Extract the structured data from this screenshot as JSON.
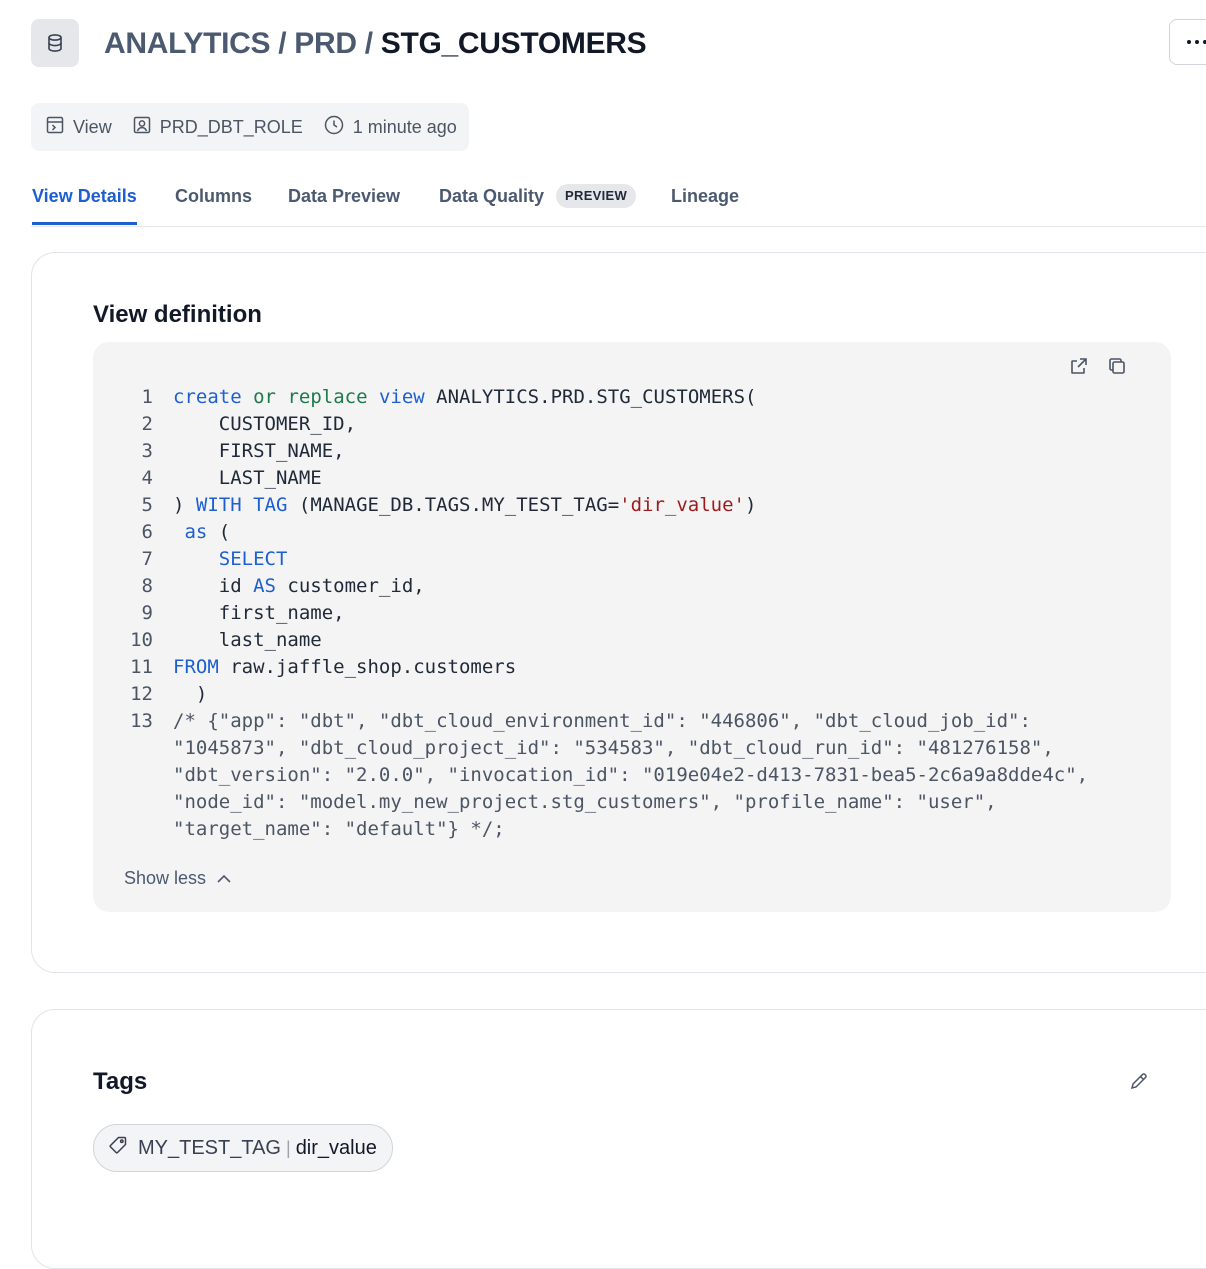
{
  "header": {
    "breadcrumb": [
      "ANALYTICS",
      "PRD",
      "STG_CUSTOMERS"
    ],
    "separator": "/",
    "icon": "database-icon",
    "more_icon": "more-horizontal-icon"
  },
  "meta": {
    "type_label": "View",
    "owner": "PRD_DBT_ROLE",
    "updated": "1 minute ago"
  },
  "tabs": [
    {
      "label": "View Details",
      "active": true
    },
    {
      "label": "Columns"
    },
    {
      "label": "Data Preview"
    },
    {
      "label": "Data Quality",
      "badge": "PREVIEW"
    },
    {
      "label": "Lineage"
    }
  ],
  "view_definition": {
    "title": "View definition",
    "line_numbers": [
      "1",
      "2",
      "3",
      "4",
      "5",
      "6",
      "7",
      "8",
      "9",
      "10",
      "11",
      "12",
      "13"
    ],
    "code": {
      "l1_kw1": "create",
      "l1_kw2": "or",
      "l1_kw3": "replace",
      "l1_kw4": "view",
      "l1_rest": " ANALYTICS.PRD.STG_CUSTOMERS(",
      "l2": "    CUSTOMER_ID,",
      "l3": "    FIRST_NAME,",
      "l4": "    LAST_NAME",
      "l5_pre": ") ",
      "l5_kw1": "WITH",
      "l5_kw2": "TAG",
      "l5_mid": " (MANAGE_DB.TAGS.MY_TEST_TAG=",
      "l5_str": "'dir_value'",
      "l5_end": ")",
      "l6_pre": " ",
      "l6_kw": "as",
      "l6_end": " (",
      "l7_pre": "    ",
      "l7_kw": "SELECT",
      "l8_pre": "    id ",
      "l8_kw": "AS",
      "l8_end": " customer_id,",
      "l9": "    first_name,",
      "l10": "    last_name",
      "l11_kw": "FROM",
      "l11_end": " raw.jaffle_shop.customers",
      "l12": "  )",
      "l13": "/* {\"app\": \"dbt\", \"dbt_cloud_environment_id\": \"446806\", \"dbt_cloud_job_id\": \"1045873\", \"dbt_cloud_project_id\": \"534583\", \"dbt_cloud_run_id\": \"481276158\", \"dbt_version\": \"2.0.0\", \"invocation_id\": \"019e04e2-d413-7831-bea5-2c6a9a8dde4c\", \"node_id\": \"model.my_new_project.stg_customers\", \"profile_name\": \"user\", \"target_name\": \"default\"} */;"
    },
    "show_less": "Show less"
  },
  "tags_section": {
    "title": "Tags",
    "tags": [
      {
        "key": "MY_TEST_TAG",
        "separator": "|",
        "value": "dir_value"
      }
    ]
  },
  "colors": {
    "accent": "#1d5fd1",
    "keyword_green": "#1d7a4a",
    "string_red": "#9b1c1c"
  }
}
